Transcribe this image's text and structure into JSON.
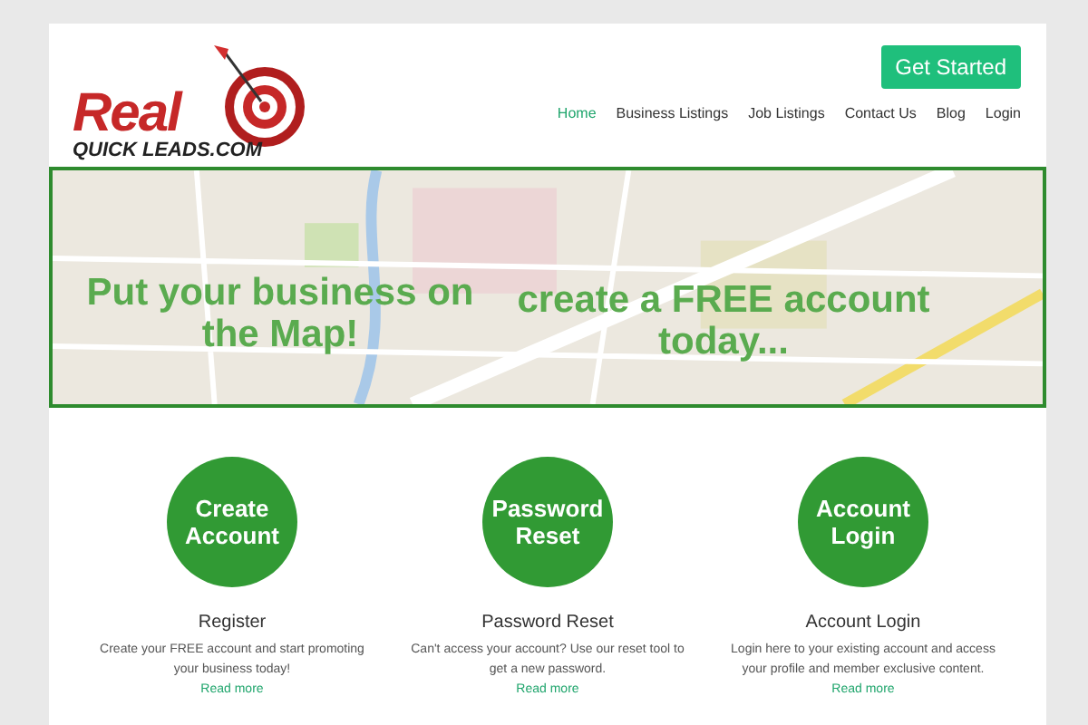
{
  "logo": {
    "word": "Real",
    "subtitle": "QUICK LEADS.COM"
  },
  "header": {
    "cta": "Get Started"
  },
  "nav": [
    {
      "label": "Home",
      "selected": true
    },
    {
      "label": "Business Listings",
      "selected": false
    },
    {
      "label": "Job Listings",
      "selected": false
    },
    {
      "label": "Contact Us",
      "selected": false
    },
    {
      "label": "Blog",
      "selected": false
    },
    {
      "label": "Login",
      "selected": false
    }
  ],
  "banner": {
    "left_text": "Put your business on the Map!",
    "right_text": "create a FREE account today..."
  },
  "features": [
    {
      "circle": "Create Account",
      "title": "Register",
      "text": "Create your FREE account and start promoting your business today!",
      "link": "Read more"
    },
    {
      "circle": "Password Reset",
      "title": "Password Reset",
      "text": "Can't access your account? Use our reset tool to get a new password.",
      "link": "Read more"
    },
    {
      "circle": "Account Login",
      "title": "Account Login",
      "text": "Login here to your existing account and access your profile and member exclusive content.",
      "link": "Read more"
    }
  ]
}
